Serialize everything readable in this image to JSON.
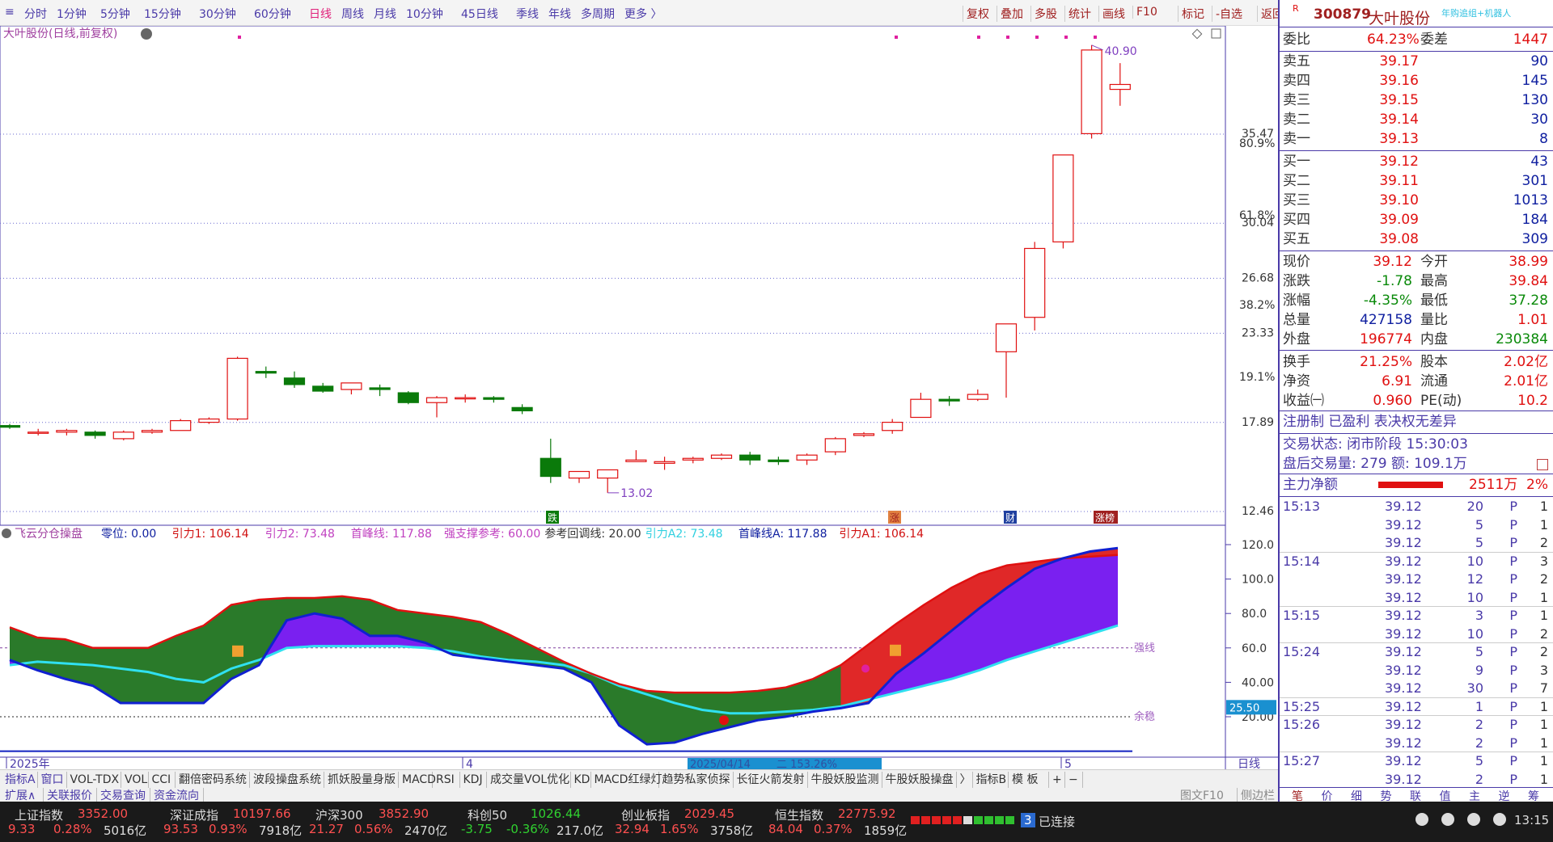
{
  "toolbar": {
    "timeframes": [
      "分时",
      "1分钟",
      "5分钟",
      "15分钟",
      "30分钟",
      "60分钟",
      "日线",
      "周线",
      "月线",
      "10分钟",
      "45日线",
      "季线",
      "年线",
      "多周期",
      "更多 〉"
    ],
    "active": "日线",
    "tools": [
      "复权",
      "叠加",
      "多股",
      "统计",
      "画线",
      "F10",
      "标记",
      "-自选",
      "返回"
    ]
  },
  "chart": {
    "title": "大叶股份(日线,前复权)",
    "price_labels": [
      "35.47",
      "30.04",
      "26.68",
      "23.33",
      "17.89",
      "12.46"
    ],
    "pct_labels": [
      "80.9%",
      "61.8%",
      "38.2%",
      "19.1%"
    ],
    "high_label": "40.90",
    "low_label": "13.02",
    "date_labels": [
      "2025年",
      "4",
      "5"
    ],
    "cursor_date": "2025/04/14",
    "cursor_info": "二 153.26%",
    "markers": [
      "跌",
      "涨",
      "财",
      "涨榜"
    ],
    "period": "日线"
  },
  "indicator": {
    "name": "飞云分仓操盘",
    "params": [
      {
        "label": "零位: 0.00",
        "color": "#1020a0"
      },
      {
        "label": "引力1: 106.14",
        "color": "#d01010"
      },
      {
        "label": "引力2: 73.48",
        "color": "#c040c0"
      },
      {
        "label": "首峰线: 117.88",
        "color": "#c040c0"
      },
      {
        "label": "强支撑参考: 60.00",
        "color": "#c040c0"
      },
      {
        "label": "参考回调线: 20.00",
        "color": "#333"
      },
      {
        "label": "引力A2: 73.48",
        "color": "#30d0e0"
      },
      {
        "label": "首峰线A: 117.88",
        "color": "#1020a0"
      },
      {
        "label": "引力A1: 106.14",
        "color": "#d01010"
      }
    ],
    "axis": [
      "120.0",
      "100.0",
      "80.0",
      "60.0",
      "40.00",
      "20.00"
    ],
    "current_value": "25.50",
    "line_labels": [
      "强线",
      "余稳"
    ]
  },
  "chart_data": {
    "type": "candlestick",
    "candles": [
      {
        "o": 17.7,
        "h": 17.8,
        "l": 17.5,
        "c": 17.6
      },
      {
        "o": 17.3,
        "h": 17.5,
        "l": 17.1,
        "c": 17.3
      },
      {
        "o": 17.3,
        "h": 17.5,
        "l": 17.1,
        "c": 17.4
      },
      {
        "o": 17.3,
        "h": 17.4,
        "l": 16.9,
        "c": 17.1
      },
      {
        "o": 16.9,
        "h": 17.4,
        "l": 16.8,
        "c": 17.3
      },
      {
        "o": 17.3,
        "h": 17.5,
        "l": 17.2,
        "c": 17.4
      },
      {
        "o": 17.4,
        "h": 18.1,
        "l": 17.4,
        "c": 18.0
      },
      {
        "o": 17.9,
        "h": 18.2,
        "l": 17.8,
        "c": 18.1
      },
      {
        "o": 18.1,
        "h": 21.9,
        "l": 18.0,
        "c": 21.8
      },
      {
        "o": 21.0,
        "h": 21.3,
        "l": 20.6,
        "c": 20.9
      },
      {
        "o": 20.6,
        "h": 21.0,
        "l": 20.0,
        "c": 20.2
      },
      {
        "o": 20.1,
        "h": 20.3,
        "l": 19.7,
        "c": 19.8
      },
      {
        "o": 19.9,
        "h": 20.3,
        "l": 19.6,
        "c": 20.3
      },
      {
        "o": 20.0,
        "h": 20.2,
        "l": 19.5,
        "c": 19.9
      },
      {
        "o": 19.7,
        "h": 19.8,
        "l": 19.0,
        "c": 19.1
      },
      {
        "o": 19.1,
        "h": 19.5,
        "l": 18.2,
        "c": 19.4
      },
      {
        "o": 19.4,
        "h": 19.6,
        "l": 19.1,
        "c": 19.4
      },
      {
        "o": 19.4,
        "h": 19.5,
        "l": 19.1,
        "c": 19.3
      },
      {
        "o": 18.8,
        "h": 19.0,
        "l": 18.4,
        "c": 18.6
      },
      {
        "o": 15.7,
        "h": 16.9,
        "l": 14.2,
        "c": 14.6
      },
      {
        "o": 14.5,
        "h": 14.9,
        "l": 14.2,
        "c": 14.9
      },
      {
        "o": 14.5,
        "h": 15.0,
        "l": 13.6,
        "c": 15.0
      },
      {
        "o": 15.5,
        "h": 16.2,
        "l": 15.5,
        "c": 15.6
      },
      {
        "o": 15.4,
        "h": 15.8,
        "l": 15.0,
        "c": 15.5
      },
      {
        "o": 15.6,
        "h": 15.8,
        "l": 15.4,
        "c": 15.7
      },
      {
        "o": 15.7,
        "h": 16.0,
        "l": 15.6,
        "c": 15.9
      },
      {
        "o": 15.9,
        "h": 16.1,
        "l": 15.3,
        "c": 15.6
      },
      {
        "o": 15.6,
        "h": 15.8,
        "l": 15.3,
        "c": 15.5
      },
      {
        "o": 15.6,
        "h": 16.0,
        "l": 15.3,
        "c": 15.9
      },
      {
        "o": 16.1,
        "h": 17.0,
        "l": 15.9,
        "c": 16.9
      },
      {
        "o": 17.1,
        "h": 17.3,
        "l": 17.0,
        "c": 17.2
      },
      {
        "o": 17.4,
        "h": 18.1,
        "l": 17.2,
        "c": 17.9
      },
      {
        "o": 18.2,
        "h": 19.7,
        "l": 18.2,
        "c": 19.3
      },
      {
        "o": 19.3,
        "h": 19.5,
        "l": 18.9,
        "c": 19.2
      },
      {
        "o": 19.3,
        "h": 19.9,
        "l": 19.2,
        "c": 19.6
      },
      {
        "o": 22.2,
        "h": 23.9,
        "l": 19.4,
        "c": 23.9
      },
      {
        "o": 24.3,
        "h": 28.9,
        "l": 23.5,
        "c": 28.5
      },
      {
        "o": 28.9,
        "h": 34.2,
        "l": 28.5,
        "c": 34.2
      },
      {
        "o": 35.5,
        "h": 40.9,
        "l": 35.2,
        "c": 40.6
      },
      {
        "o": 38.2,
        "h": 39.8,
        "l": 37.2,
        "c": 38.5
      }
    ]
  },
  "quote": {
    "code": "300879",
    "name": "大叶股份",
    "tag": "R",
    "group": "年购追组+机器人",
    "weibi_label": "委比",
    "weibi": "64.23%",
    "weicha_label": "委差",
    "weicha": "1447",
    "asks": [
      {
        "label": "卖五",
        "price": "39.17",
        "vol": "90"
      },
      {
        "label": "卖四",
        "price": "39.16",
        "vol": "145"
      },
      {
        "label": "卖三",
        "price": "39.15",
        "vol": "130"
      },
      {
        "label": "卖二",
        "price": "39.14",
        "vol": "30"
      },
      {
        "label": "卖一",
        "price": "39.13",
        "vol": "8"
      }
    ],
    "bids": [
      {
        "label": "买一",
        "price": "39.12",
        "vol": "43"
      },
      {
        "label": "买二",
        "price": "39.11",
        "vol": "301"
      },
      {
        "label": "买三",
        "price": "39.10",
        "vol": "1013"
      },
      {
        "label": "买四",
        "price": "39.09",
        "vol": "184"
      },
      {
        "label": "买五",
        "price": "39.08",
        "vol": "309"
      }
    ],
    "stats": [
      {
        "l1": "现价",
        "v1": "39.12",
        "c1": "red",
        "l2": "今开",
        "v2": "38.99",
        "c2": "red"
      },
      {
        "l1": "涨跌",
        "v1": "-1.78",
        "c1": "grn",
        "l2": "最高",
        "v2": "39.84",
        "c2": "red"
      },
      {
        "l1": "涨幅",
        "v1": "-4.35%",
        "c1": "grn",
        "l2": "最低",
        "v2": "37.28",
        "c2": "grn"
      },
      {
        "l1": "总量",
        "v1": "427158",
        "c1": "blu",
        "l2": "量比",
        "v2": "1.01",
        "c2": "red"
      },
      {
        "l1": "外盘",
        "v1": "196774",
        "c1": "red",
        "l2": "内盘",
        "v2": "230384",
        "c2": "grn"
      }
    ],
    "stats2": [
      {
        "l1": "换手",
        "v1": "21.25%",
        "l2": "股本",
        "v2": "2.02亿"
      },
      {
        "l1": "净资",
        "v1": "6.91",
        "l2": "流通",
        "v2": "2.01亿"
      },
      {
        "l1": "收益㈠",
        "v1": "0.960",
        "l2": "PE(动)",
        "v2": "10.2"
      }
    ],
    "reg": "注册制 已盈利 表决权无差异",
    "status": "交易状态: 闭市阶段 15:30:03",
    "after": "盘后交易量: 279  额: 109.1万",
    "main_flow_label": "主力净额",
    "main_flow": "2511万",
    "main_flow_pct": "2%",
    "ticks": [
      {
        "t": "15:13",
        "p": "39.12",
        "v": "20",
        "f": "P",
        "n": "1"
      },
      {
        "t": "",
        "p": "39.12",
        "v": "5",
        "f": "P",
        "n": "1"
      },
      {
        "t": "",
        "p": "39.12",
        "v": "5",
        "f": "P",
        "n": "2"
      },
      {
        "t": "15:14",
        "p": "39.12",
        "v": "10",
        "f": "P",
        "n": "3"
      },
      {
        "t": "",
        "p": "39.12",
        "v": "12",
        "f": "P",
        "n": "2"
      },
      {
        "t": "",
        "p": "39.12",
        "v": "10",
        "f": "P",
        "n": "1"
      },
      {
        "t": "15:15",
        "p": "39.12",
        "v": "3",
        "f": "P",
        "n": "1"
      },
      {
        "t": "",
        "p": "39.12",
        "v": "10",
        "f": "P",
        "n": "2"
      },
      {
        "t": "15:24",
        "p": "39.12",
        "v": "5",
        "f": "P",
        "n": "2"
      },
      {
        "t": "",
        "p": "39.12",
        "v": "9",
        "f": "P",
        "n": "3"
      },
      {
        "t": "",
        "p": "39.12",
        "v": "30",
        "f": "P",
        "n": "7"
      },
      {
        "t": "15:25",
        "p": "39.12",
        "v": "1",
        "f": "P",
        "n": "1"
      },
      {
        "t": "15:26",
        "p": "39.12",
        "v": "2",
        "f": "P",
        "n": "1"
      },
      {
        "t": "",
        "p": "39.12",
        "v": "2",
        "f": "P",
        "n": "1"
      },
      {
        "t": "15:27",
        "p": "39.12",
        "v": "5",
        "f": "P",
        "n": "1"
      },
      {
        "t": "",
        "p": "39.12",
        "v": "2",
        "f": "P",
        "n": "1"
      }
    ],
    "bottom_tabs": [
      "笔",
      "价",
      "细",
      "势",
      "联",
      "值",
      "主",
      "逆",
      "筹"
    ]
  },
  "indicator_tabs": [
    "指标A",
    "窗口",
    "VOL-TDX",
    "VOL",
    "CCI",
    "翻倍密码系统",
    "波段操盘系统",
    "抓妖股量身版",
    "MACD",
    "RSI",
    "KDJ",
    "成交量VOL优化",
    "KD",
    "MACD红绿灯",
    "趋势私家侦探",
    "长征火箭发射",
    "牛股妖股监测",
    "牛股妖股操盘",
    "〉",
    "指标B",
    "模 板",
    "+",
    "−"
  ],
  "sub_tabs": [
    "扩展∧",
    "关联报价",
    "交易查询",
    "资金流向"
  ],
  "side_tabs": [
    "图文F10",
    "侧边栏〈"
  ],
  "indices": [
    {
      "name": "上证指数",
      "value": "3352.00",
      "chg": "9.33",
      "pct": "0.28%",
      "amt": "5016亿"
    },
    {
      "name": "深证成指",
      "value": "10197.66",
      "chg": "93.53",
      "pct": "0.93%",
      "amt": "7918亿"
    },
    {
      "name": "沪深300",
      "value": "3852.90",
      "chg": "21.27",
      "pct": "0.56%",
      "amt": "2470亿"
    },
    {
      "name": "科创50",
      "value": "1026.44",
      "chg": "-3.75",
      "pct": "-0.36%",
      "amt": "217.0亿"
    },
    {
      "name": "创业板指",
      "value": "2029.45",
      "chg": "32.94",
      "pct": "1.65%",
      "amt": "3758亿"
    },
    {
      "name": "恒生指数",
      "value": "22775.92",
      "chg": "84.04",
      "pct": "0.37%",
      "amt": "1859亿"
    }
  ],
  "connection": {
    "count": "3",
    "label": "已连接"
  },
  "clock": "13:15"
}
